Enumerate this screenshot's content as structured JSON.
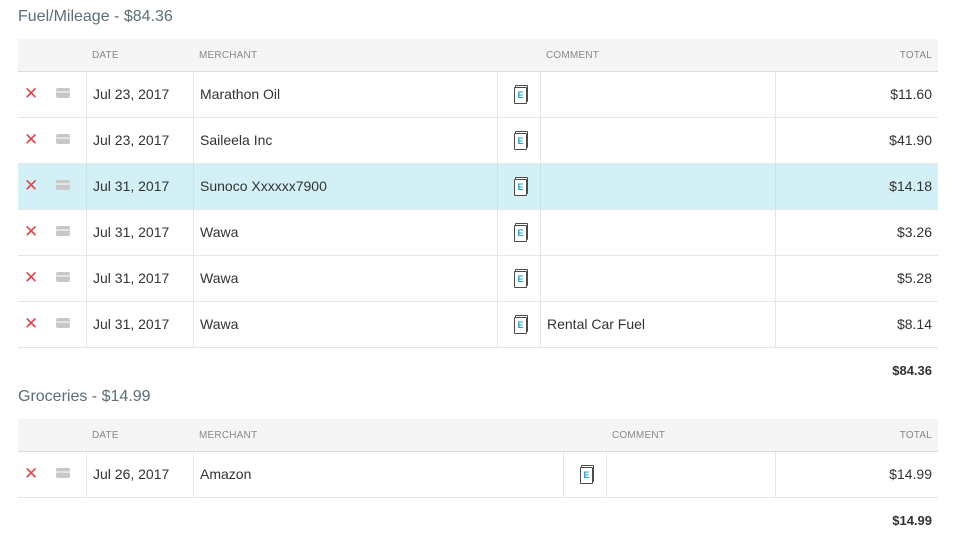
{
  "sections": [
    {
      "title": "Fuel/Mileage - $84.36",
      "headers": {
        "date": "DATE",
        "merchant": "MERCHANT",
        "comment": "COMMENT",
        "total": "TOTAL"
      },
      "rows": [
        {
          "date": "Jul 23, 2017",
          "merchant": "Marathon Oil",
          "comment": "",
          "total": "$11.60",
          "receipt_letter": "E"
        },
        {
          "date": "Jul 23, 2017",
          "merchant": "Saileela Inc",
          "comment": "",
          "total": "$41.90",
          "receipt_letter": "E"
        },
        {
          "date": "Jul 31, 2017",
          "merchant": "Sunoco Xxxxxx7900",
          "comment": "",
          "total": "$14.18",
          "receipt_letter": "E",
          "selected": true
        },
        {
          "date": "Jul 31, 2017",
          "merchant": "Wawa",
          "comment": "",
          "total": "$3.26",
          "receipt_letter": "E"
        },
        {
          "date": "Jul 31, 2017",
          "merchant": "Wawa",
          "comment": "",
          "total": "$5.28",
          "receipt_letter": "E"
        },
        {
          "date": "Jul 31, 2017",
          "merchant": "Wawa",
          "comment": "Rental Car Fuel",
          "total": "$8.14",
          "receipt_letter": "E"
        }
      ],
      "subtotal": "$84.36"
    },
    {
      "title": "Groceries - $14.99",
      "headers": {
        "date": "DATE",
        "merchant": "MERCHANT",
        "comment": "COMMENT",
        "total": "TOTAL"
      },
      "rows": [
        {
          "date": "Jul 26, 2017",
          "merchant": "Amazon",
          "comment": "",
          "total": "$14.99",
          "receipt_letter": "E"
        }
      ],
      "subtotal": "$14.99"
    }
  ],
  "icons": {
    "delete": "delete-x-icon",
    "card": "credit-card-icon",
    "receipt": "receipt-icon"
  },
  "colors": {
    "delete": "#e0474c",
    "selected_row": "#d2f0f5",
    "receipt_letter": "#1aa3c9",
    "section_title": "#5a6e7a"
  }
}
